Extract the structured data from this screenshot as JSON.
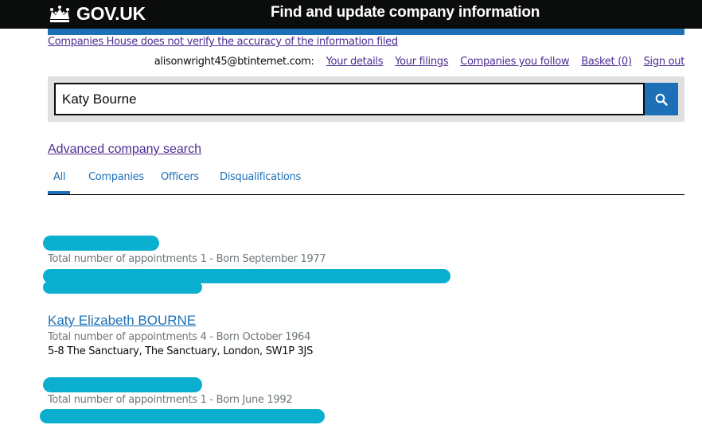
{
  "header": {
    "logo_text": "GOV.UK",
    "service_name": "Find and update company information"
  },
  "disclaimer": "Companies House does not verify the accuracy of the information filed",
  "account": {
    "email": "alisonwright45@btinternet.com:",
    "links": [
      "Your details",
      "Your filings",
      "Companies you follow",
      "Basket (0)",
      "Sign out"
    ]
  },
  "search": {
    "value": "Katy Bourne",
    "button_icon": "search-icon"
  },
  "advanced_search_label": "Advanced company search",
  "tabs": [
    {
      "label": "All",
      "active": true
    },
    {
      "label": "Companies",
      "active": false
    },
    {
      "label": "Officers",
      "active": false
    },
    {
      "label": "Disqualifications",
      "active": false
    }
  ],
  "results": [
    {
      "title": "",
      "meta": "Total number of appointments 1 - Born September 1977",
      "address": ""
    },
    {
      "title": "Katy Elizabeth BOURNE",
      "meta": "Total number of appointments 4 - Born October 1964",
      "address": "5-8 The Sanctuary, The Sanctuary, London, SW1P 3JS"
    },
    {
      "title": "",
      "meta": "Total number of appointments 1 - Born June 1992",
      "address": ""
    }
  ],
  "colors": {
    "header_bg": "#0b0c0c",
    "brand_blue": "#1d70b8",
    "visited_link": "#4c2c92",
    "redaction": "#0aafcf"
  }
}
